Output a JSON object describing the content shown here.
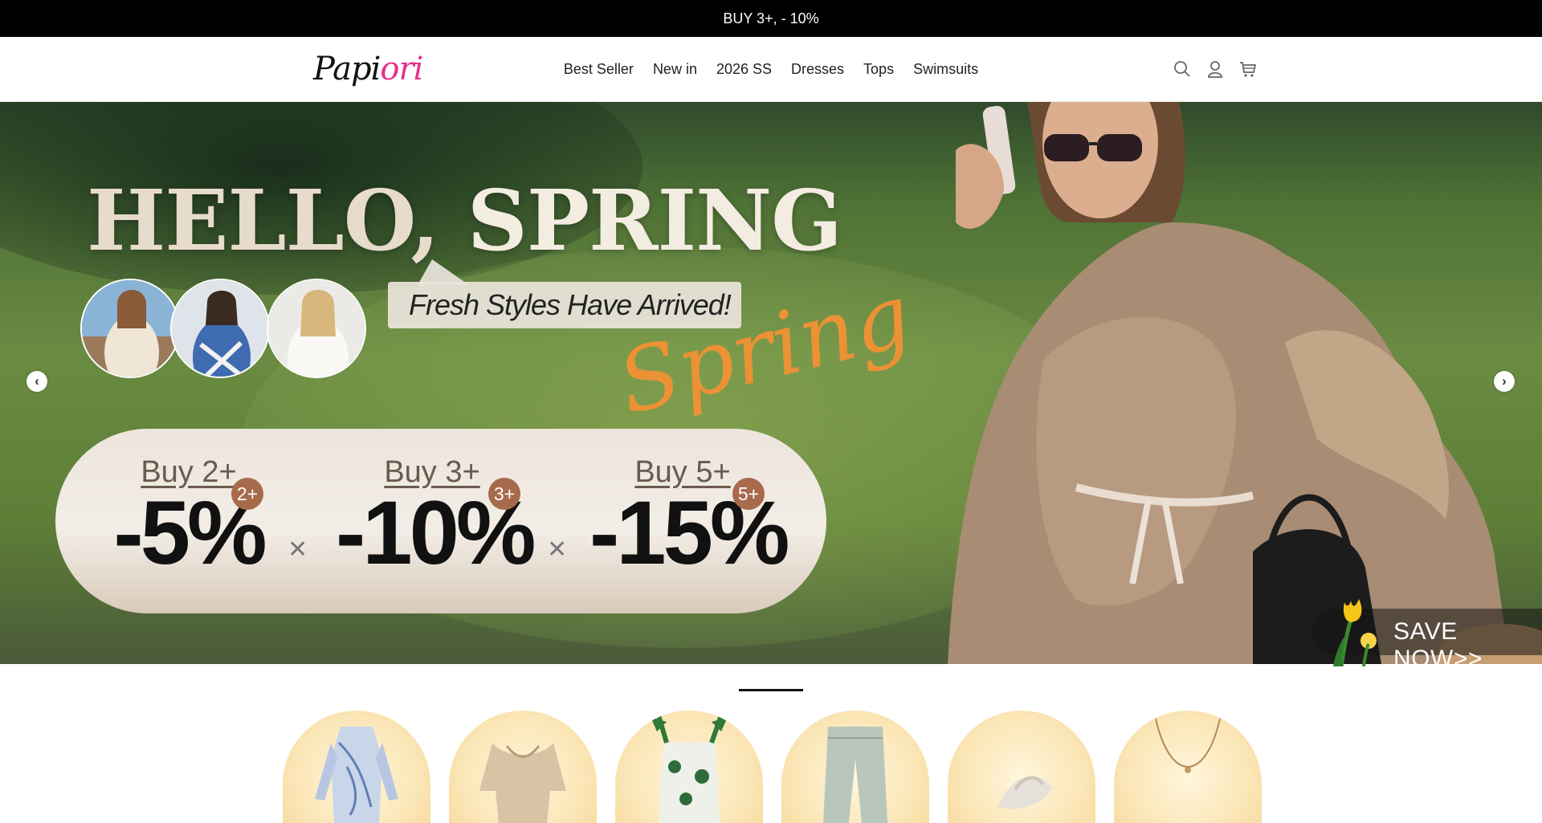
{
  "announcement": "BUY 3+, - 10%",
  "header": {
    "logo_text": "Papi",
    "logo_accent": "ori",
    "nav": [
      "Best Seller",
      "New in",
      "2026 SS",
      "Dresses",
      "Tops",
      "Swimsuits"
    ],
    "icons": [
      "search-icon",
      "account-icon",
      "cart-icon"
    ]
  },
  "hero": {
    "headline_a": "HELLO,",
    "headline_b": "SPRING",
    "subheadline": "Fresh Styles Have Arrived!",
    "script_word": "Spring",
    "offers": [
      {
        "buy": "Buy 2+",
        "tag": "2+",
        "discount": "-5%"
      },
      {
        "buy": "Buy 3+",
        "tag": "3+",
        "discount": "-10%"
      },
      {
        "buy": "Buy 5+",
        "tag": "5+",
        "discount": "-15%"
      }
    ],
    "cta": "SAVE NOW>>",
    "colors": {
      "script": "#f29234",
      "tag": "#a86a4c",
      "brand_accent": "#e2318a"
    }
  }
}
